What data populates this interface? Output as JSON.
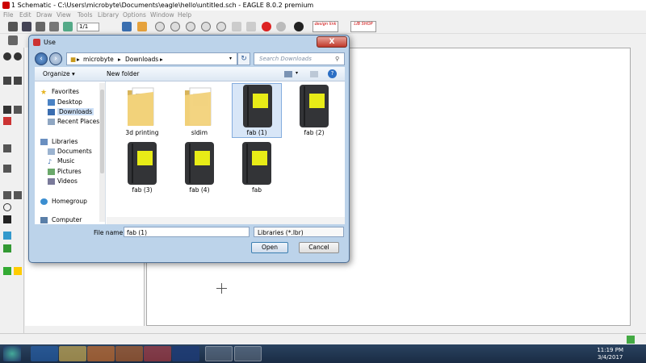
{
  "window": {
    "title": "1 Schematic - C:\\Users\\microbyte\\Documents\\eagle\\hello\\untitled.sch - EAGLE 8.0.2 premium"
  },
  "menu": [
    "File",
    "Edit",
    "Draw",
    "View",
    "Tools",
    "Library",
    "Options",
    "Window",
    "Help"
  ],
  "toolbar": {
    "zoom_value": "1/1",
    "brand1": "design link",
    "brand2": "LIB SHOP"
  },
  "dialog": {
    "title": "Use",
    "close_label": "X",
    "path": [
      "microbyte",
      "Downloads"
    ],
    "search_placeholder": "Search Downloads",
    "organize_label": "Organize ▾",
    "new_folder_label": "New folder",
    "nav": {
      "favorites": "Favorites",
      "desktop": "Desktop",
      "downloads": "Downloads",
      "recent": "Recent Places",
      "libraries": "Libraries",
      "documents": "Documents",
      "music": "Music",
      "pictures": "Pictures",
      "videos": "Videos",
      "homegroup": "Homegroup",
      "computer": "Computer"
    },
    "files": [
      {
        "name": "3d printing",
        "kind": "folder",
        "selected": false
      },
      {
        "name": "sldim",
        "kind": "folder",
        "selected": false
      },
      {
        "name": "fab (1)",
        "kind": "library",
        "selected": true
      },
      {
        "name": "fab (2)",
        "kind": "library",
        "selected": false
      },
      {
        "name": "fab (3)",
        "kind": "library",
        "selected": false
      },
      {
        "name": "fab (4)",
        "kind": "library",
        "selected": false
      },
      {
        "name": "fab",
        "kind": "library",
        "selected": false
      }
    ],
    "file_name_label": "File name:",
    "file_name_value": "fab (1)",
    "filter_value": "Libraries (*.lbr)",
    "open_label": "Open",
    "cancel_label": "Cancel"
  },
  "taskbar": {
    "time": "11:19 PM",
    "date": "3/4/2017"
  },
  "colors": {
    "dialog_frame": "#bcd3ea",
    "library_square": "#e8ec17",
    "taskbar": "#1f3450"
  }
}
